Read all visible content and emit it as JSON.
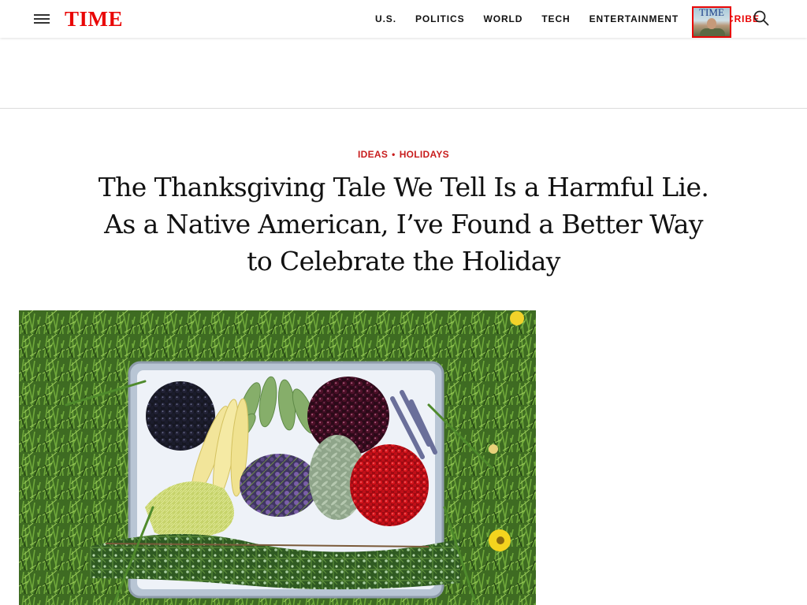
{
  "header": {
    "logo": "TIME",
    "nav": [
      "U.S.",
      "POLITICS",
      "WORLD",
      "TECH",
      "ENTERTAINMENT"
    ],
    "subscribe": "SUBSCRIBE",
    "cover_title": "TIME"
  },
  "article": {
    "categories": [
      "IDEAS",
      "HOLIDAYS"
    ],
    "separator": "•",
    "headline_lines": [
      "The Thanksgiving Tale We Tell Is a Harmful Lie.",
      "As a Native American, I’ve Found a Better Way",
      "to Celebrate the Holiday"
    ]
  },
  "colors": {
    "brand_red": "#e90606",
    "kicker_red": "#c81d1d"
  },
  "icons": {
    "menu": "hamburger-menu-icon",
    "search": "search-icon"
  },
  "hero_image": "tray of berries, corn, okra and herbs on grass"
}
